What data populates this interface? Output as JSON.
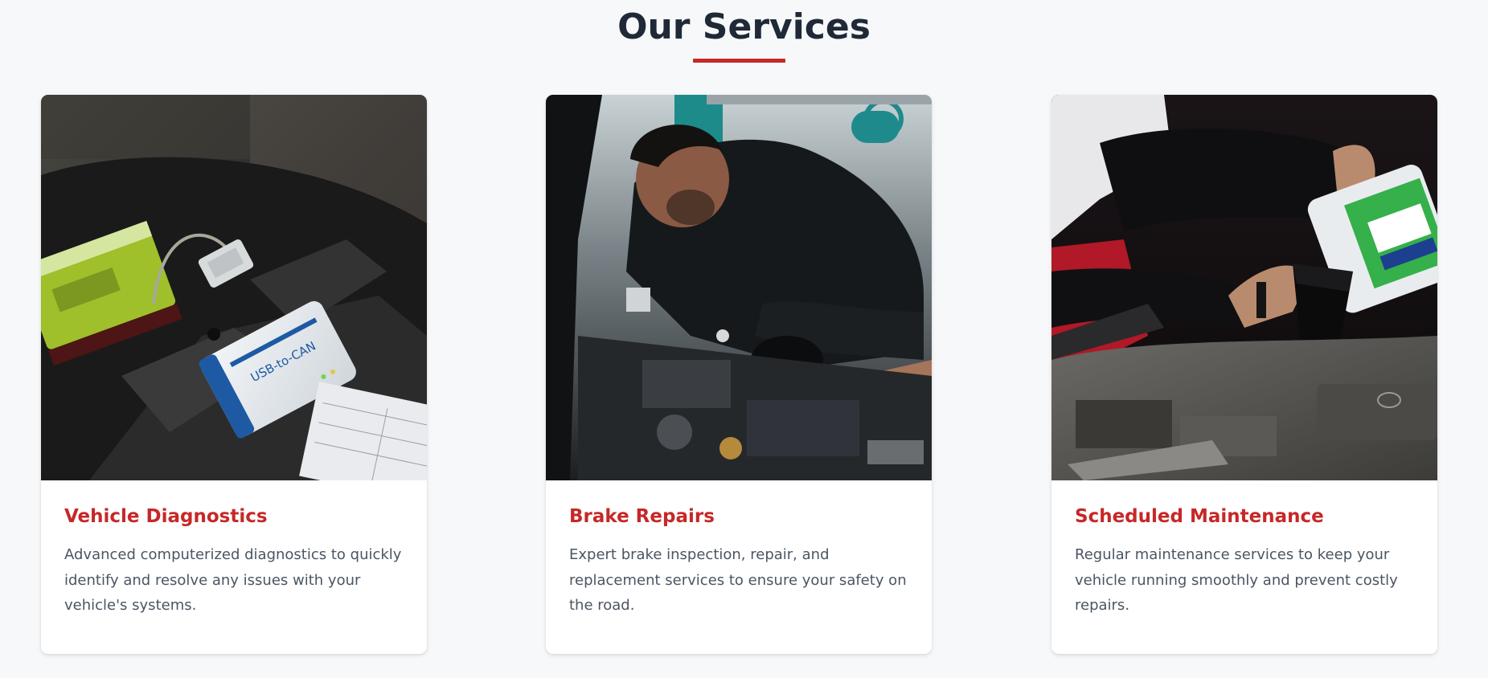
{
  "section": {
    "title": "Our Services",
    "accent_color": "#c62828"
  },
  "services": [
    {
      "title": "Vehicle Diagnostics",
      "description": "Advanced computerized diagnostics to quickly identify and resolve any issues with your vehicle's systems.",
      "image_alt": "USB-to-CAN diagnostic interface plugged into a vehicle",
      "image_label": "USB-to-CAN"
    },
    {
      "title": "Brake Repairs",
      "description": "Expert brake inspection, repair, and replacement services to ensure your safety on the road.",
      "image_alt": "Mechanic working on an engine bay"
    },
    {
      "title": "Scheduled Maintenance",
      "description": "Regular maintenance services to keep your vehicle running smoothly and prevent costly repairs.",
      "image_alt": "Pouring engine oil through a funnel into an engine"
    }
  ]
}
